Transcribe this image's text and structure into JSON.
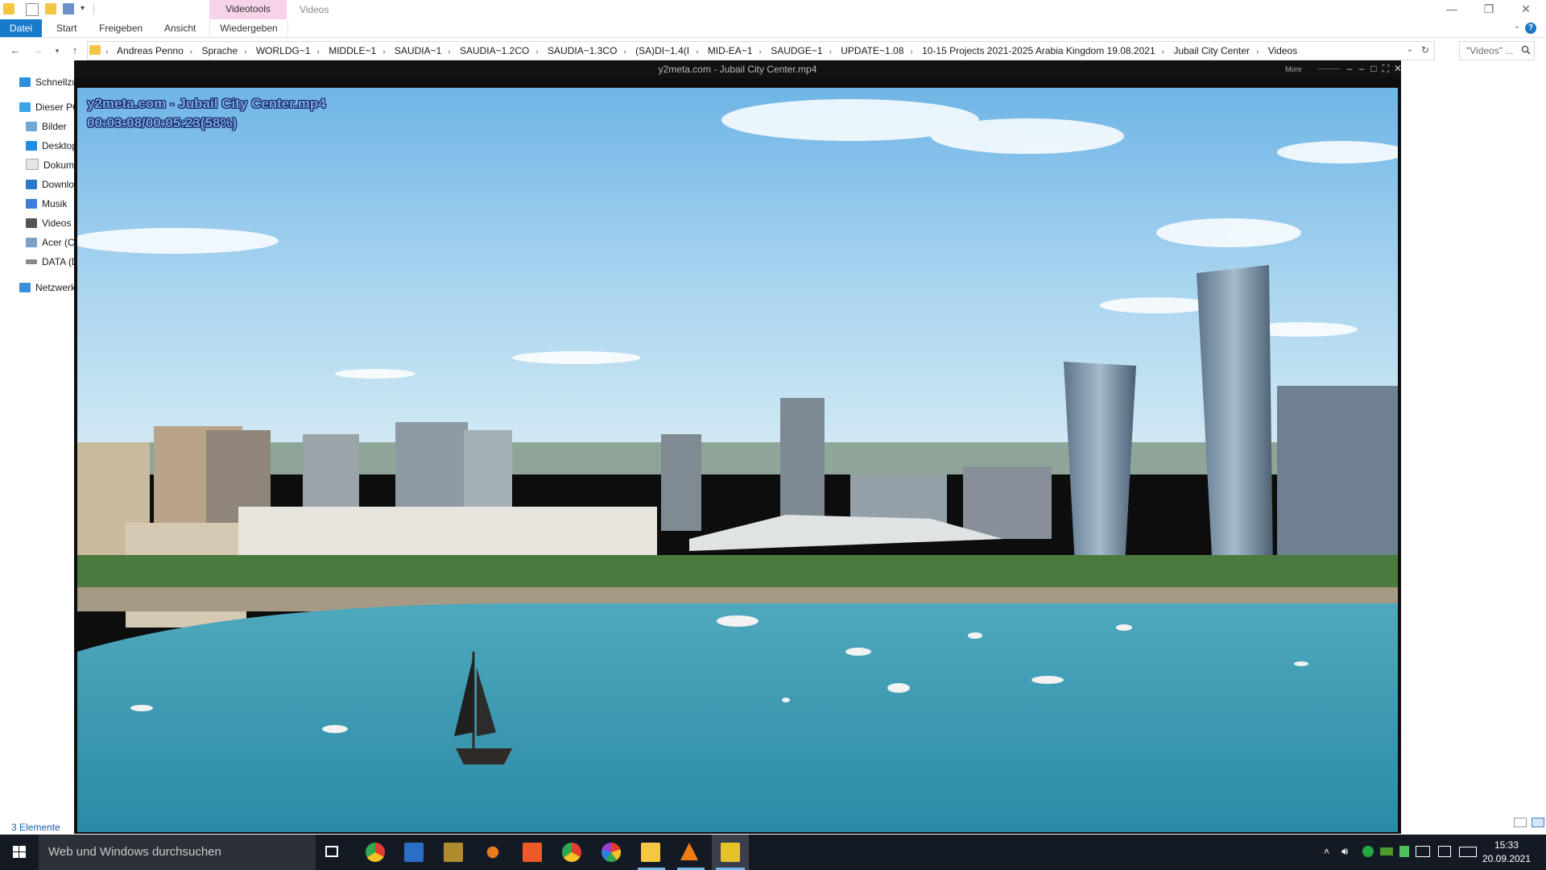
{
  "explorer": {
    "quick_access_dropdown": "▾",
    "context_tab_group": "Videotools",
    "window_title": "Videos",
    "window_controls": {
      "minimize": "—",
      "restore": "❐",
      "close": "✕"
    },
    "ribbon_tabs": [
      "Datei",
      "Start",
      "Freigeben",
      "Ansicht",
      "Wiedergeben"
    ],
    "help_label": "?",
    "breadcrumbs": [
      "Andreas Penno",
      "Sprache",
      "WORLDG~1",
      "MIDDLE~1",
      "SAUDIA~1",
      "SAUDIA~1.2CO",
      "SAUDIA~1.3CO",
      "(SA)DI~1.4(I",
      "MID-EA~1",
      "SAUDGE~1",
      "UPDATE~1.08",
      "10-15 Projects 2021-2025 Arabia Kingdom 19.08.2021",
      "Jubail City Center",
      "Videos"
    ],
    "search_placeholder": "\"Videos\" ...",
    "nav_items": [
      "Schnellzugriff",
      "Dieser PC",
      "Bilder",
      "Desktop",
      "Dokumente",
      "Downloads",
      "Musik",
      "Videos",
      "Acer (C:)",
      "DATA (D:)",
      "Netzwerk"
    ],
    "status_item_count": "3 Elemente"
  },
  "player": {
    "title": "y2meta.com - Jubail City Center.mp4",
    "more_label": "More",
    "osd_filename": "y2meta.com - Jubail City Center.mp4",
    "osd_time": "00:03:08/00:05:23(58%)",
    "progress": 0.58
  },
  "taskbar": {
    "search_placeholder": "Web und Windows durchsuchen",
    "clock_time": "15:33",
    "clock_date": "20.09.2021",
    "pinned_icons": [
      "task-view-icon",
      "chrome-icon",
      "paint-icon",
      "photo-viewer-icon",
      "app-icon",
      "office-icon",
      "chrome-icon",
      "picasa-icon",
      "file-explorer-icon",
      "vlc-icon",
      "media-player-icon"
    ]
  },
  "colors": {
    "accent": "#1979ca",
    "context_tab": "#f6d3e8",
    "osd_text": "#7aa6ea",
    "taskbar": "#141a24"
  }
}
